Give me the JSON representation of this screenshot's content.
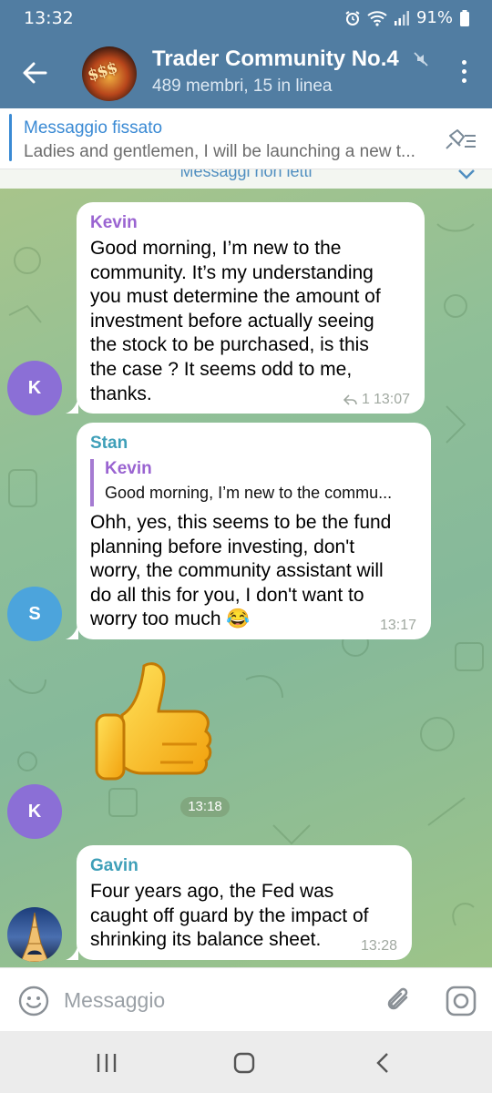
{
  "status_bar": {
    "time": "13:32",
    "battery": "91%"
  },
  "header": {
    "title": "Trader Community No.4",
    "subtitle": "489 membri, 15 in linea",
    "avatar_text": "$$$"
  },
  "pinned": {
    "title": "Messaggio fissato",
    "text": "Ladies and gentlemen, I will be launching a new t..."
  },
  "unread_label": "Messaggi non letti",
  "messages": [
    {
      "sender": "Kevin",
      "sender_color": "#9a64d1",
      "avatar_letter": "K",
      "lines": [
        "Good morning, I’m new to the",
        "community. It’s my understanding",
        "you must determine the amount of",
        "investment before actually seeing",
        "the stock to be purchased, is this",
        "the case ? It seems odd to me,",
        "thanks."
      ],
      "replies": "1",
      "time": "13:07"
    },
    {
      "sender": "Stan",
      "sender_color": "#3e9fb8",
      "avatar_letter": "S",
      "quote_sender": "Kevin",
      "quote_text": "Good morning, I’m new to the commu...",
      "lines": [
        "Ohh, yes, this seems to be the fund",
        "planning before investing, don't",
        "worry, the community assistant will",
        "do all this for you, I don't want to",
        "worry too much 😂"
      ],
      "time": "13:17"
    },
    {
      "sender": "Kevin",
      "avatar_letter": "K",
      "sticker": "thumbs-up",
      "time": "13:18"
    },
    {
      "sender": "Gavin",
      "sender_color": "#3e9fb8",
      "lines": [
        "Four years ago, the Fed was",
        "caught off guard by the impact of",
        "shrinking its balance sheet."
      ],
      "time": "13:28"
    }
  ],
  "composer": {
    "placeholder": "Messaggio"
  },
  "colors": {
    "header": "#517da2",
    "accent": "#3a8ad4",
    "kevin_avatar": "#8b6fd6",
    "stan_avatar": "#4ca4dc"
  }
}
